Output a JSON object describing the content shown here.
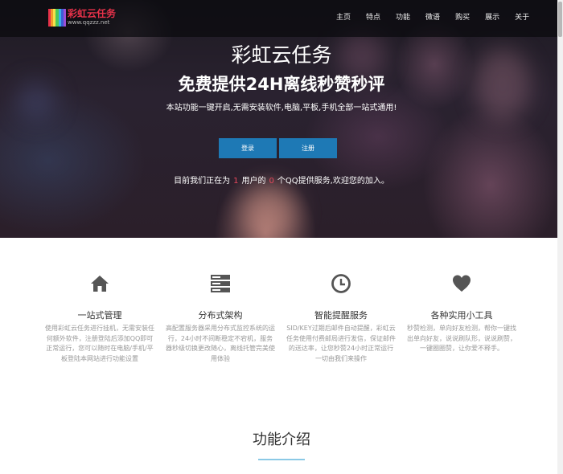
{
  "brand": {
    "title": "彩虹云任务",
    "subtitle": "www.qqzzz.net",
    "bar_colors": [
      "#e8324a",
      "#f29b2b",
      "#f6e04a",
      "#4cc75a",
      "#3ab0e8",
      "#3b5fd6",
      "#9b4ed6"
    ]
  },
  "nav": {
    "items": [
      {
        "label": "主页"
      },
      {
        "label": "特点"
      },
      {
        "label": "功能"
      },
      {
        "label": "微语"
      },
      {
        "label": "购买"
      },
      {
        "label": "展示"
      },
      {
        "label": "关于"
      }
    ]
  },
  "hero": {
    "title": "彩虹云任务",
    "subtitle": "免费提供24H离线秒赞秒评",
    "description": "本站功能一键开启,无需安装软件,电脑,平板,手机全部一站式通用!",
    "login_label": "登录",
    "register_label": "注册",
    "stats_prefix": "目前我们正在为",
    "user_count": "1",
    "stats_middle": "用户的",
    "qq_count": "0",
    "stats_suffix": "个QQ提供服务,欢迎您的加入。"
  },
  "features": [
    {
      "icon": "home-icon",
      "title": "一站式管理",
      "description": "使用彩虹云任务进行挂机，无需安装任何额外软件，注册登陆后添加QQ即可正常运行，您可以随时在电脑/手机/平板登陆本网站进行功能设置"
    },
    {
      "icon": "server-icon",
      "title": "分布式架构",
      "description": "高配置服务器采用分布式监控系统的运行，24小时不间断稳定不宕机，服务器秒级切换更改随心，离线托管完美使用体验"
    },
    {
      "icon": "clock-icon",
      "title": "智能提醒服务",
      "description": "SID/KEY过期后邮件自动提醒，彩虹云任务使用付费邮局进行发信，保证邮件的送达率，让您秒赞24小时正常运行一切由我们来操作"
    },
    {
      "icon": "heart-icon",
      "title": "各种实用小工具",
      "description": "秒赞检测，单向好友检测，帮你一键找出单向好友，说说刷队形，说说刷赞，一键圈圈赞，让你爱不释手。"
    }
  ],
  "section": {
    "title": "功能介绍"
  },
  "colors": {
    "accent_button": "#1e79b5",
    "highlight_number": "#e8485c",
    "underline": "#8bc9e6"
  }
}
